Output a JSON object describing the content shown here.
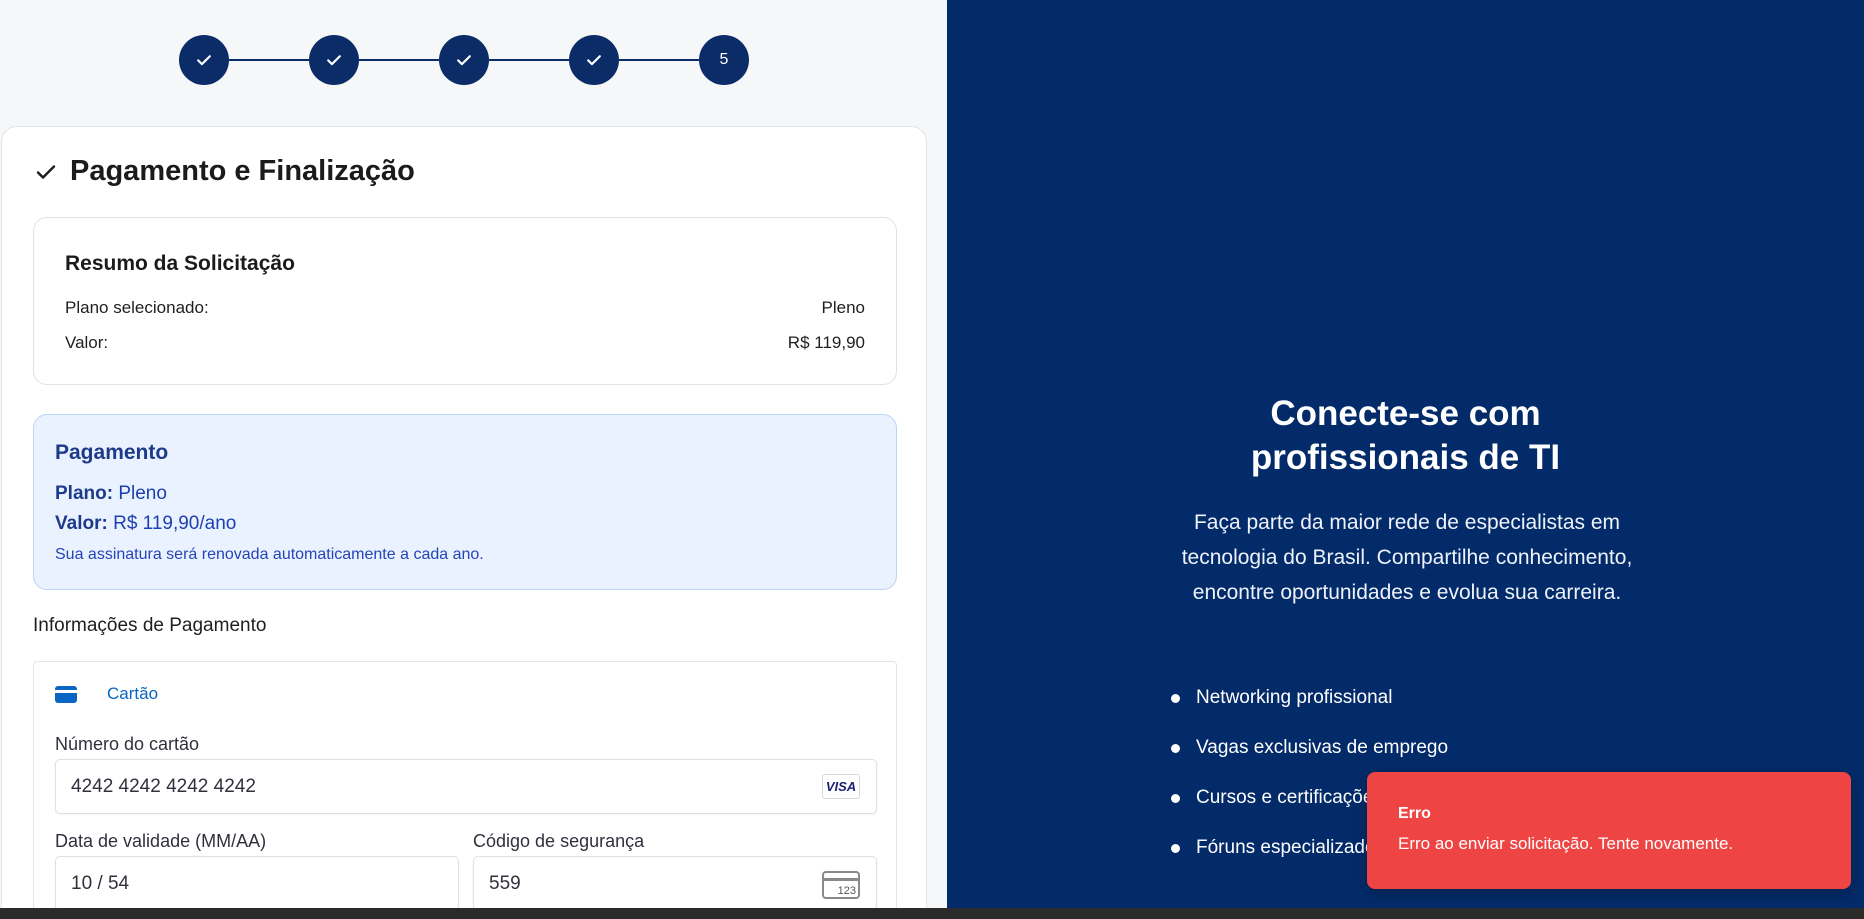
{
  "stepper": {
    "steps": [
      {
        "state": "done",
        "icon": "check-icon"
      },
      {
        "state": "done",
        "icon": "check-icon"
      },
      {
        "state": "done",
        "icon": "check-icon"
      },
      {
        "state": "done",
        "icon": "check-icon"
      },
      {
        "state": "current",
        "label": "5"
      }
    ],
    "color": "#0b2c66"
  },
  "section": {
    "title": "Pagamento e Finalização"
  },
  "summary": {
    "title": "Resumo da Solicitação",
    "plan_label": "Plano selecionado:",
    "plan_value": "Pleno",
    "value_label": "Valor:",
    "value_value": "R$ 119,90"
  },
  "payment_box": {
    "title": "Pagamento",
    "plan_label": "Plano:",
    "plan_value": "Pleno",
    "value_label": "Valor:",
    "value_value": "R$ 119,90/ano",
    "note": "Sua assinatura será renovada automaticamente a cada ano."
  },
  "payment_info": {
    "title": "Informações de Pagamento",
    "method_tab": "Cartão",
    "card_number_label": "Número do cartão",
    "card_number_value": "4242 4242 4242 4242",
    "card_brand": "VISA",
    "expiry_label": "Data de validade (MM/AA)",
    "expiry_value": "10 / 54",
    "cvc_label": "Código de segurança",
    "cvc_value": "559",
    "cvc_icon_text": "123"
  },
  "hero": {
    "title_line1": "Conecte-se com",
    "title_line2": "profissionais de TI",
    "text": "Faça parte da maior rede de especialistas em tecnologia do Brasil. Compartilhe conhecimento, encontre oportunidades e evolua sua carreira.",
    "features": [
      "Networking profissional",
      "Vagas exclusivas de emprego",
      "Cursos e certificações",
      "Fóruns especializados"
    ],
    "background": "#032b69"
  },
  "toast": {
    "title": "Erro",
    "message": "Erro ao enviar solicitação. Tente novamente.",
    "color": "#ef4444"
  }
}
